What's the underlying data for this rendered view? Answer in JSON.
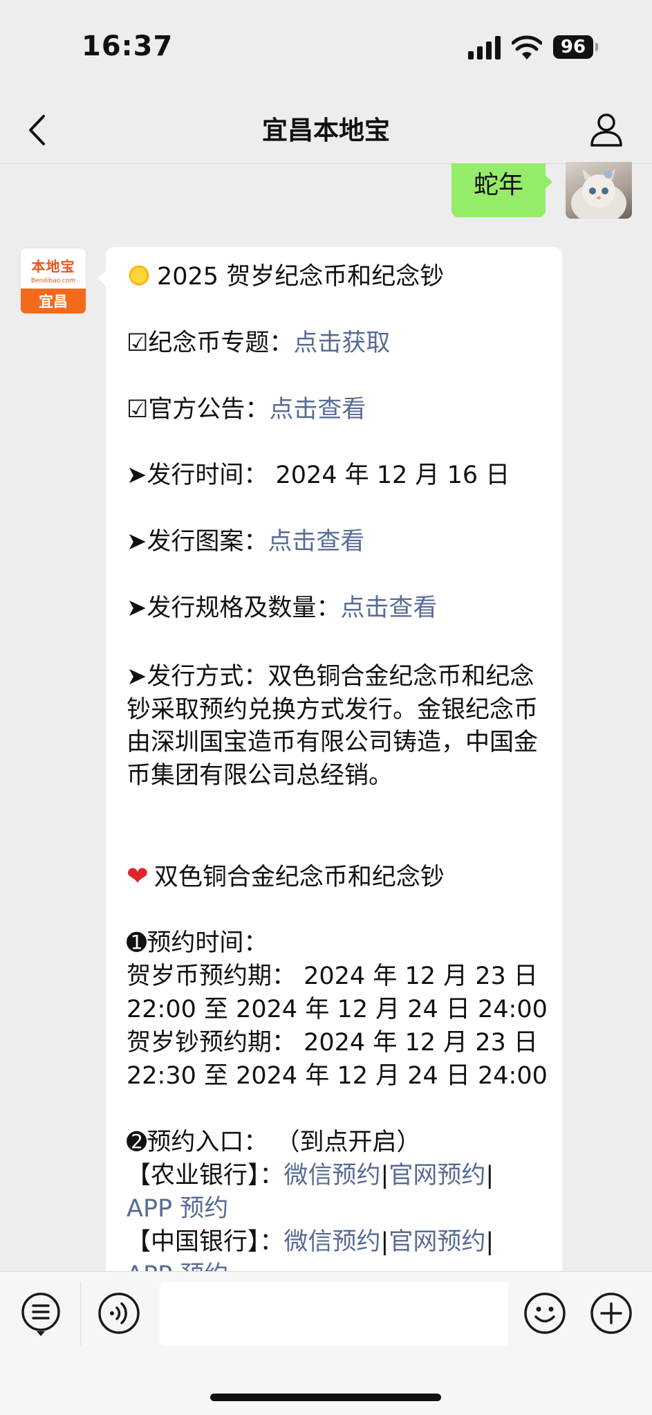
{
  "status_bar": {
    "time": "16:37",
    "battery": "96"
  },
  "nav": {
    "title": "宜昌本地宝",
    "back_icon": "chevron-left-icon",
    "profile_icon": "person-icon"
  },
  "outgoing_message": {
    "text": "蛇年"
  },
  "official_account": {
    "brand": "本地宝",
    "site": "Bendibao.com",
    "city": "宜昌"
  },
  "article": {
    "heading": "2025 贺岁纪念币和纪念钞",
    "topic_label": "☑纪念币专题：",
    "topic_link": "点击获取",
    "notice_label": "☑官方公告：",
    "notice_link": "点击查看",
    "date_line": "➤发行时间：  2024 年 12 月 16 日",
    "pattern_label": "➤发行图案：",
    "pattern_link": "点击查看",
    "spec_label": "➤发行规格及数量：",
    "spec_link": "点击查看",
    "method_text": "➤发行方式：双色铜合金纪念币和纪念钞采取预约兑换方式发行。金银纪念币由深圳国宝造币有限公司铸造，中国金币集团有限公司总经销。",
    "section_title": "双色铜合金纪念币和纪念钞",
    "res_time_label": "➊预约时间：",
    "coin_period_1": "贺岁币预约期：  2024 年 12 月 23 日",
    "coin_period_2": "22:00 至 2024 年 12 月 24 日 24:00",
    "note_period_1": "贺岁钞预约期：  2024 年 12 月 23 日",
    "note_period_2": "22:30 至 2024 年 12 月 24 日 24:00",
    "entry_label": "➋预约入口：   （到点开启）",
    "banks": [
      {
        "name": "【农业银行】：",
        "wechat": "微信预约",
        "web": "官网预约",
        "app": "APP 预约"
      },
      {
        "name": "【中国银行】：",
        "wechat": "微信预约",
        "web": "官网预约",
        "app": "APP 预约"
      }
    ],
    "separator": "|"
  },
  "input_bar": {
    "list_icon": "list-icon",
    "voice_icon": "voice-icon",
    "emoji_icon": "emoji-icon",
    "plus_icon": "plus-icon"
  }
}
